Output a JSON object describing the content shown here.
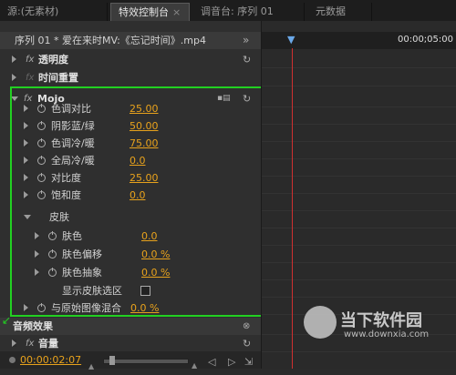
{
  "tabs": [
    {
      "label": "源:(无素材)",
      "active": false
    },
    {
      "label": "特效控制台",
      "active": true,
      "close": "×"
    },
    {
      "label": "调音台: 序列 01",
      "active": false
    },
    {
      "label": "元数据",
      "active": false
    }
  ],
  "panel": {
    "clip_title": "序列 01 * 爱在来时MV:《忘记时间》.mp4",
    "timecode_end": "00:00;05:00",
    "current_time": "00:00:02:07"
  },
  "effects": {
    "opacity": "透明度",
    "time_remap": "时间重置",
    "mojo": "Mojo",
    "audio_effects": "音频效果",
    "volume": "音量",
    "fx": "fx"
  },
  "mojo_params": [
    {
      "label": "色调对比",
      "value": "25.00"
    },
    {
      "label": "阴影蓝/绿",
      "value": "50.00"
    },
    {
      "label": "色调冷/暖",
      "value": "75.00"
    },
    {
      "label": "全局冷/暖",
      "value": "0.0"
    },
    {
      "label": "对比度",
      "value": "25.00"
    },
    {
      "label": "饱和度",
      "value": "0.0"
    }
  ],
  "skin": {
    "group_label": "皮肤",
    "params": [
      {
        "label": "肤色",
        "value": "0.0"
      },
      {
        "label": "肤色偏移",
        "value": "0.0 %"
      },
      {
        "label": "肤色抽象",
        "value": "0.0 %"
      }
    ],
    "show_selection_label": "显示皮肤选区"
  },
  "blend": {
    "label": "与原始图像混合",
    "value": "0.0 %"
  },
  "watermark": {
    "site": "当下软件园",
    "url": "www.downxia.com"
  }
}
